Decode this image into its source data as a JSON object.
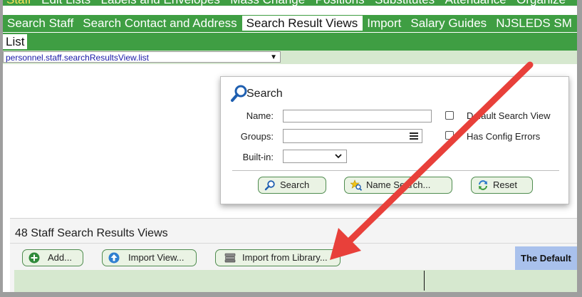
{
  "top_menu": [
    "Staff",
    "Edit Lists",
    "Labels and Envelopes",
    "Mass Change",
    "Positions",
    "Substitutes",
    "Attendance",
    "Organize"
  ],
  "nav_tabs": [
    {
      "label": "Search Staff",
      "active": false
    },
    {
      "label": "Search Contact and Address",
      "active": false
    },
    {
      "label": "Search Result Views",
      "active": true
    },
    {
      "label": "Import",
      "active": false
    },
    {
      "label": "Salary Guides",
      "active": false
    },
    {
      "label": "NJSLEDS SM",
      "active": false
    }
  ],
  "list_tab": "List",
  "view_select": {
    "value": "personnel.staff.searchResultsView.list"
  },
  "search_panel": {
    "title": "Search",
    "fields": {
      "name_label": "Name:",
      "groups_label": "Groups:",
      "builtin_label": "Built-in:"
    },
    "checkboxes": {
      "default_view": "Default Search View",
      "config_errors": "Has Config Errors"
    },
    "buttons": {
      "search": "Search",
      "name_search": "Name Search...",
      "reset": "Reset"
    }
  },
  "results": {
    "title": "48 Staff Search Results Views",
    "buttons": {
      "add": "Add...",
      "import_view": "Import View...",
      "import_library": "Import from Library..."
    },
    "default_cell": "The Default"
  },
  "colors": {
    "nav_green": "#3f9e43",
    "light_green": "#d6e8cf",
    "button_border": "#4f8c4f",
    "annotation_red": "#e8403a",
    "default_cell_blue": "#a9c1ec"
  }
}
